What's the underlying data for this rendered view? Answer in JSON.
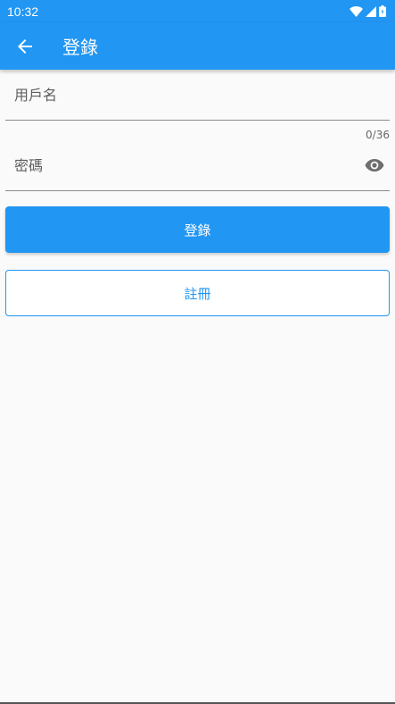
{
  "status_bar": {
    "time": "10:32"
  },
  "app_bar": {
    "title": "登錄",
    "back_icon": "arrow-back-icon"
  },
  "form": {
    "username_placeholder": "用戶名",
    "username_counter": "0/36",
    "password_placeholder": "密碼",
    "password_toggle_icon": "eye-icon"
  },
  "buttons": {
    "login_label": "登錄",
    "register_label": "註冊"
  },
  "colors": {
    "primary": "#2196f3",
    "background": "#fafafa"
  }
}
